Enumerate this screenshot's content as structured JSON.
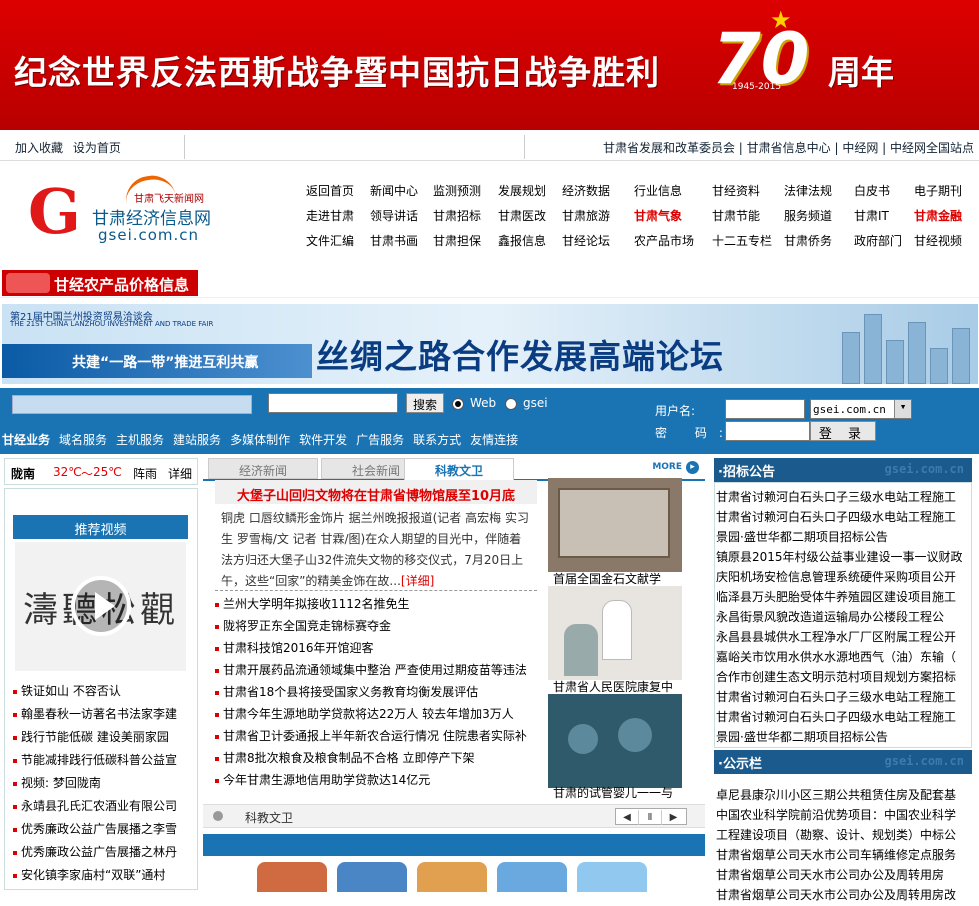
{
  "banner": {
    "text": "纪念世界反法西斯战争暨中国抗日战争胜利",
    "number": "70",
    "years": "1945-2015",
    "suffix": "周年"
  },
  "topbar": {
    "left": [
      "加入收藏",
      "设为首页"
    ],
    "right": "甘肃省发展和改革委员会 | 甘肃省信息中心 | 中经网 | 中经网全国站点"
  },
  "logo": {
    "letter": "G",
    "fly_text": "甘肃飞天新闻网",
    "cn_name": "甘肃经济信息网",
    "domain": "gsei.com.cn"
  },
  "nav": {
    "rows": [
      [
        "返回首页",
        "新闻中心",
        "监测预测",
        "发展规划",
        "经济数据",
        "行业信息",
        "甘经资料",
        "法律法规",
        "白皮书",
        "电子期刊"
      ],
      [
        "走进甘肃",
        "领导讲话",
        "甘肃招标",
        "甘肃医改",
        "甘肃旅游",
        "甘肃气象",
        "甘肃节能",
        "服务频道",
        "甘肃IT",
        "甘肃金融"
      ],
      [
        "文件汇编",
        "甘肃书画",
        "甘肃担保",
        "鑫报信息",
        "甘经论坛",
        "农产品市场",
        "十二五专栏",
        "甘肃侨务",
        "政府部门",
        "甘经视频"
      ]
    ],
    "red": [
      "甘肃气象",
      "甘肃金融"
    ]
  },
  "agri_banner": "甘经农产品价格信息",
  "ad": {
    "line1": "第21届中国兰州投资贸易洽谈会",
    "line2": "THE 21ST CHINA LANZHOU INVESTMENT AND TRADE FAIR",
    "slogan": "共建“一路一带”推进互利共赢",
    "title": "丝绸之路合作发展高端论坛"
  },
  "search": {
    "button": "搜索",
    "radio_web": "Web",
    "radio_site": "gsei",
    "username_label": "用户名:",
    "password_label": "密  码:",
    "domain_select": "gsei.com.cn",
    "login_button": "登 录"
  },
  "services": [
    "甘经业务",
    "域名服务",
    "主机服务",
    "建站服务",
    "多媒体制作",
    "软件开发",
    "广告服务",
    "联系方式",
    "友情连接"
  ],
  "weather": {
    "city": "陇南",
    "temp_high": "32℃",
    "sep": "～",
    "temp_low": "25℃",
    "condition": "阵雨",
    "detail": "详细"
  },
  "left": {
    "header": "推荐视频",
    "calligraphy": "濤聽松觀",
    "items": [
      "铁证如山 不容否认",
      "翰墨春秋一访著名书法家李建",
      "践行节能低碳 建设美丽家园",
      "节能减排践行低碳科普公益宣",
      "视频: 梦回陇南",
      "永靖县孔氏汇农酒业有限公司",
      "优秀廉政公益广告展播之李雪",
      "优秀廉政公益广告展播之林丹",
      "安化镇李家庙村“双联”通村"
    ]
  },
  "middle": {
    "tabs": [
      "经济新闻",
      "社会新闻",
      "科教文卫"
    ],
    "active_tab": "科教文卫",
    "more": "MORE",
    "headline": "大堡子山回归文物将在甘肃省博物馆展至10月底",
    "summary": "铜虎 口唇纹鳞形金饰片 据兰州晚报报道(记者 高宏梅 实习生 罗雪梅/文 记者 甘霖/图)在众人期望的目光中，伴随着法方归还大堡子山32件流失文物的移交仪式，7月20日上午，这些“回家”的精美金饰在故...",
    "detail": "[详细]",
    "news": [
      "兰州大学明年拟接收1112名推免生",
      "陇将罗正东全国竞走锦标赛夺金",
      "甘肃科技馆2016年开馆迎客",
      "甘肃开展药品流通领域集中整治 严查使用过期疫苗等违法",
      "甘肃省18个县将接受国家义务教育均衡发展评估",
      "甘肃今年生源地助学贷款将达22万人 较去年增加3万人",
      "甘肃省卫计委通报上半年新农合运行情况 住院患者实际补",
      "甘肃8批次粮食及粮食制品不合格 立即停产下架",
      "今年甘肃生源地信用助学贷款达14亿元"
    ],
    "photos": [
      "首届全国金石文献学",
      "甘肃省人民医院康复中",
      "甘肃的试管婴儿一一与"
    ],
    "bottom_label": "科教文卫",
    "ctl": [
      "◀",
      "Ⅱ",
      "▶"
    ]
  },
  "right": {
    "watermark": "gsei.com.cn",
    "bids_title": "·招标公告",
    "bids": [
      "甘肃省讨赖河白石头口子三级水电站工程施工",
      "甘肃省讨赖河白石头口子四级水电站工程施工",
      "景园·盛世华都二期项目招标公告",
      "镇原县2015年村级公益事业建设一事一议财政",
      "庆阳机场安检信息管理系统硬件采购项目公开",
      "临泽县万头肥胎受体牛养殖园区建设项目施工",
      "永昌街景风貌改造道运输局办公楼段工程公",
      "永昌县县城供水工程净水厂厂区附属工程公开",
      "嘉峪关市饮用水供水水源地西气（油）东输（",
      "合作市创建生态文明示范村项目规划方案招标",
      "甘肃省讨赖河白石头口子三级水电站工程施工",
      "甘肃省讨赖河白石头口子四级水电站工程施工",
      "景园·盛世华都二期项目招标公告"
    ],
    "notice_title": "·公示栏",
    "notices": [
      "卓尼县康尕川小区三期公共租赁住房及配套基",
      "中国农业科学院前沿优势项目：中国农业科学",
      "工程建设项目（勘察、设计、规划类）中标公",
      "甘肃省烟草公司天水市公司车辆维修定点服务",
      "甘肃省烟草公司天水市公司办公及周转用房",
      "甘肃省烟草公司天水市公司办公及周转用房改"
    ]
  },
  "colors": {
    "brand_red": "#cc0000",
    "brand_blue": "#1a74b4",
    "dark_blue": "#1a5a8c"
  }
}
